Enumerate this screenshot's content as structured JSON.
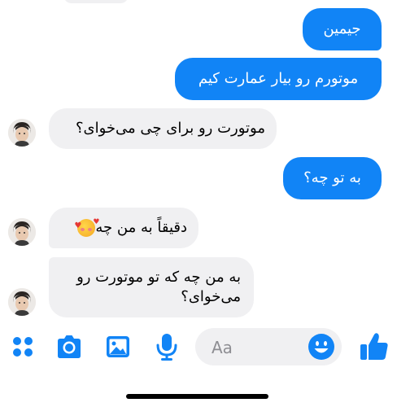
{
  "conversation": {
    "messages": [
      {
        "id": "m1",
        "direction": "outgoing",
        "text": "جیمین"
      },
      {
        "id": "m2",
        "direction": "outgoing",
        "text": "موتورم رو بیار عمارت کیم"
      },
      {
        "id": "m3",
        "direction": "incoming",
        "text": "موتورت رو برای چی می‌خوای؟"
      },
      {
        "id": "m4",
        "direction": "outgoing",
        "text": "به تو چه؟"
      },
      {
        "id": "m5",
        "direction": "incoming",
        "text": "دقیقاً به من چه",
        "emoji": "smiling-face-with-hearts"
      },
      {
        "id": "m6",
        "direction": "incoming",
        "text": "به من چه که تو موتورت رو می‌خوای؟"
      }
    ]
  },
  "composer": {
    "input_placeholder": "Aa",
    "icons": [
      "apps-icon",
      "camera-icon",
      "gallery-icon",
      "microphone-icon",
      "emoji-icon",
      "thumbs-up-icon"
    ]
  },
  "colors": {
    "outgoing_bubble": "#1184f6",
    "incoming_bubble": "#f0f0f2",
    "accent": "#1184f6"
  }
}
